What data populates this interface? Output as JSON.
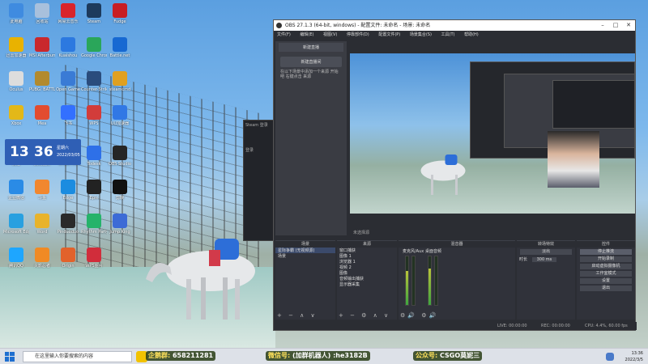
{
  "desktop": {
    "icons": [
      {
        "label": "此电脑",
        "color": "#3f8be0"
      },
      {
        "label": "回收站",
        "color": "#a8c0dc"
      },
      {
        "label": "网易云音乐",
        "color": "#d9242b"
      },
      {
        "label": "Steam",
        "color": "#1d3a5c"
      },
      {
        "label": "Fudge",
        "color": "#c81e24"
      },
      {
        "label": "迅雷加速器",
        "color": "#e9b200"
      },
      {
        "label": "MSI Afterburner",
        "color": "#c9282d"
      },
      {
        "label": "Kuaishou",
        "color": "#2c79e0"
      },
      {
        "label": "Google Chrome",
        "color": "#2aa65a"
      },
      {
        "label": "Battle.net",
        "color": "#1769d2"
      },
      {
        "label": "Oculus",
        "color": "#dddddd"
      },
      {
        "label": "PUBG: BATTLEGROUNDS",
        "color": "#b28a2e"
      },
      {
        "label": "Open Game",
        "color": "#3a7bd5"
      },
      {
        "label": "Counter-Strike",
        "color": "#2a4c7d"
      },
      {
        "label": "steamcmd",
        "color": "#e0a020"
      },
      {
        "label": "Xbox",
        "color": "#e3b818"
      },
      {
        "label": "Mea",
        "color": "#e34c2f"
      },
      {
        "label": "飞书",
        "color": "#3370ff"
      },
      {
        "label": "WPS",
        "color": "#d23c3a"
      },
      {
        "label": "UU加速器",
        "color": "#3178e5"
      },
      {
        "label": "微信",
        "color": "#2dc14d"
      },
      {
        "label": "腾讯视频",
        "color": "#1c7bef"
      },
      {
        "label": "OneDrive",
        "color": "#ffffff"
      },
      {
        "label": "Todesk",
        "color": "#2e70e8"
      },
      {
        "label": "OBS Studio",
        "color": "#262626"
      },
      {
        "label": "企业微信",
        "color": "#2a8be6"
      },
      {
        "label": "斗鱼",
        "color": "#f1872f"
      },
      {
        "label": "Edge",
        "color": "#1b8ce0"
      },
      {
        "label": "Epic",
        "color": "#222222"
      },
      {
        "label": "剪映",
        "color": "#111111"
      },
      {
        "label": "Microsoft Edge",
        "color": "#28a0e0"
      },
      {
        "label": "Word",
        "color": "#e8b32b"
      },
      {
        "label": "Pinduoduo",
        "color": "#2a2a2a"
      },
      {
        "label": "Rhythm Party",
        "color": "#25b36a"
      },
      {
        "label": "Jump King",
        "color": "#3c6bd6"
      },
      {
        "label": "腾讯QQ",
        "color": "#1ea6ff"
      },
      {
        "label": "火影忍者",
        "color": "#f08a24"
      },
      {
        "label": "Origin",
        "color": "#e2622b"
      },
      {
        "label": "WPS图片",
        "color": "#d12d3b"
      }
    ],
    "clock": {
      "hour": "13",
      "minute": "36",
      "line1": "星期六",
      "line2": "2022/03/05"
    }
  },
  "bg_window": {
    "title": "Steam 登录",
    "text": "登录"
  },
  "obs": {
    "title": "OBS 27.1.3 (64-bit, windows) - 配置文件: 未命名 - 场景: 未命名",
    "menu": [
      "文件(F)",
      "编辑(E)",
      "视图(V)",
      "停靠部件(D)",
      "配置文件(P)",
      "场景集合(S)",
      "工具(T)",
      "帮助(H)"
    ],
    "left_tab": "新建直播",
    "left_button": "新建直播间",
    "left_text": "在以下场景中添加一个来源 开始吧 右键点击 来源",
    "strip_text": "未选择源",
    "docks": {
      "scenes": {
        "title": "场景",
        "items": [
          "星际争霸 (无视频源)",
          "场景"
        ]
      },
      "sources": {
        "title": "来源",
        "items": [
          "窗口捕获",
          "图像 1",
          "浏览器 1",
          "视频 2",
          "图像",
          "音频输出捕获",
          "显示器采集"
        ]
      },
      "mixer": {
        "title": "混音器",
        "ch1": "麦克风/Aux",
        "ch2": "桌面音频"
      },
      "transitions": {
        "title": "转场特效",
        "mode": "淡出",
        "duration_label": "时长",
        "duration": "300 ms"
      },
      "controls": {
        "title": "控件",
        "buttons": [
          "停止推流",
          "开始录制",
          "启动虚拟摄像机",
          "工作室模式",
          "设置",
          "退出"
        ]
      }
    },
    "status": {
      "live": "LIVE: 00:00:00",
      "rec": "REC: 00:00:00",
      "cpu": "CPU: 4.4%, 60.00 fps"
    }
  },
  "overlay": [
    {
      "label": "企鹅群",
      "value": "658211281"
    },
    {
      "label": "微信号",
      "value": "(加群机器人) :he3182B"
    },
    {
      "label": "公众号",
      "value": "CSGO莫妮三"
    }
  ],
  "taskbar": {
    "search": "在这里输入你要搜索的内容",
    "time": "13:36",
    "date": "2022/3/5"
  }
}
